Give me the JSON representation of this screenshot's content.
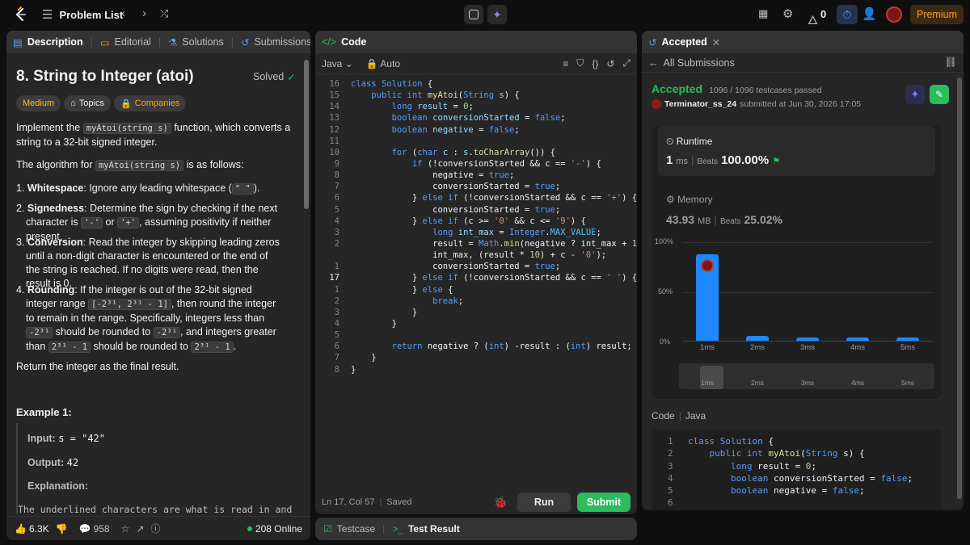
{
  "topbar": {
    "title": "Problem List",
    "premium": "Premium",
    "streak": "0"
  },
  "left": {
    "tabs": [
      "Description",
      "Editorial",
      "Solutions",
      "Submissions"
    ],
    "problem_title": "8. String to Integer (atoi)",
    "solved": "Solved",
    "tags": [
      "Medium",
      "Topics",
      "Companies"
    ],
    "intro_a": "Implement the ",
    "intro_code": "myAtoi(string s)",
    "intro_b": " function, which converts a string to a 32-bit signed integer.",
    "alg_a": "The algorithm for ",
    "alg_code": "myAtoi(string s)",
    "alg_b": " is as follows:",
    "s1_b": "Whitespace",
    "s1_t": ": Ignore any leading whitespace (",
    "s1_code": "\" \"",
    "s1_end": ").",
    "s2_b": "Signedness",
    "s2_t": ": Determine the sign by checking if the next character is ",
    "s2_c1": "'-'",
    "s2_or": " or ",
    "s2_c2": "'+'",
    "s2_end": ", assuming positivity if neither present.",
    "s3_b": "Conversion",
    "s3_t": ": Read the integer by skipping leading zeros until a non-digit character is encountered or the end of the string is reached. If no digits were read, then the result is 0.",
    "s4_b": "Rounding",
    "s4_t": ": If the integer is out of the 32-bit signed integer range ",
    "s4_range": "[-2³¹, 2³¹ - 1]",
    "s4_t2": ", then round the integer to remain in the range. Specifically, integers less than ",
    "s4_c1": "-2³¹",
    "s4_t3": " should be rounded to ",
    "s4_c2": "-2³¹",
    "s4_t4": ", and integers greater than ",
    "s4_c3": "2³¹ - 1",
    "s4_t5": " should be rounded to ",
    "s4_c4": "2³¹ - 1",
    "s4_end": ".",
    "ret": "Return the integer as the final result.",
    "example": "Example 1:",
    "input_l": "Input:",
    "input_v": "s = \"42\"",
    "output_l": "Output:",
    "output_v": "42",
    "explanation_l": "Explanation:",
    "explanation_v": "The underlined characters are what is read in and",
    "likes": "6.3K",
    "comments": "958",
    "online": "208 Online"
  },
  "code": {
    "title": "Code",
    "lang": "Java",
    "auto": "Auto",
    "status": "Ln 17, Col 57",
    "saved": "Saved",
    "run": "Run",
    "submit": "Submit",
    "testcase": "Testcase",
    "test_result": "Test Result",
    "line_numbers": [
      "16",
      "15",
      "14",
      "13",
      "12",
      "11",
      "10",
      "9",
      "8",
      "7",
      "6",
      "5",
      "4",
      "3",
      "2",
      "",
      "1",
      "17",
      "1",
      "2",
      "3",
      "4",
      "5",
      "6",
      "7",
      "8"
    ]
  },
  "right": {
    "tab": "Accepted",
    "back": "All Submissions",
    "status": "Accepted",
    "cases": "1096 / 1096 testcases passed",
    "user": "Terminator_ss_24",
    "submitted": "submitted at Jun 30, 2026 17:05",
    "runtime_l": "Runtime",
    "runtime_v": "1",
    "runtime_u": "ms",
    "beats_l": "Beats",
    "runtime_beats": "100.00%",
    "memory_l": "Memory",
    "memory_v": "43.93",
    "memory_u": "MB",
    "memory_beats": "25.02%",
    "y_ticks": [
      "100%",
      "50%",
      "0%"
    ],
    "code_l": "Code",
    "code_lang": "Java"
  },
  "chart_data": {
    "type": "bar",
    "categories": [
      "1ms",
      "2ms",
      "3ms",
      "4ms",
      "5ms"
    ],
    "values": [
      87,
      5,
      3,
      3,
      3
    ],
    "ylim": [
      0,
      100
    ],
    "y_ticks": [
      "100%",
      "50%",
      "0%"
    ]
  },
  "colors": {
    "accepted": "#2cbb5d",
    "medium": "#ffc01e",
    "premium": "#ffa116",
    "link": "#5a9cf8"
  }
}
